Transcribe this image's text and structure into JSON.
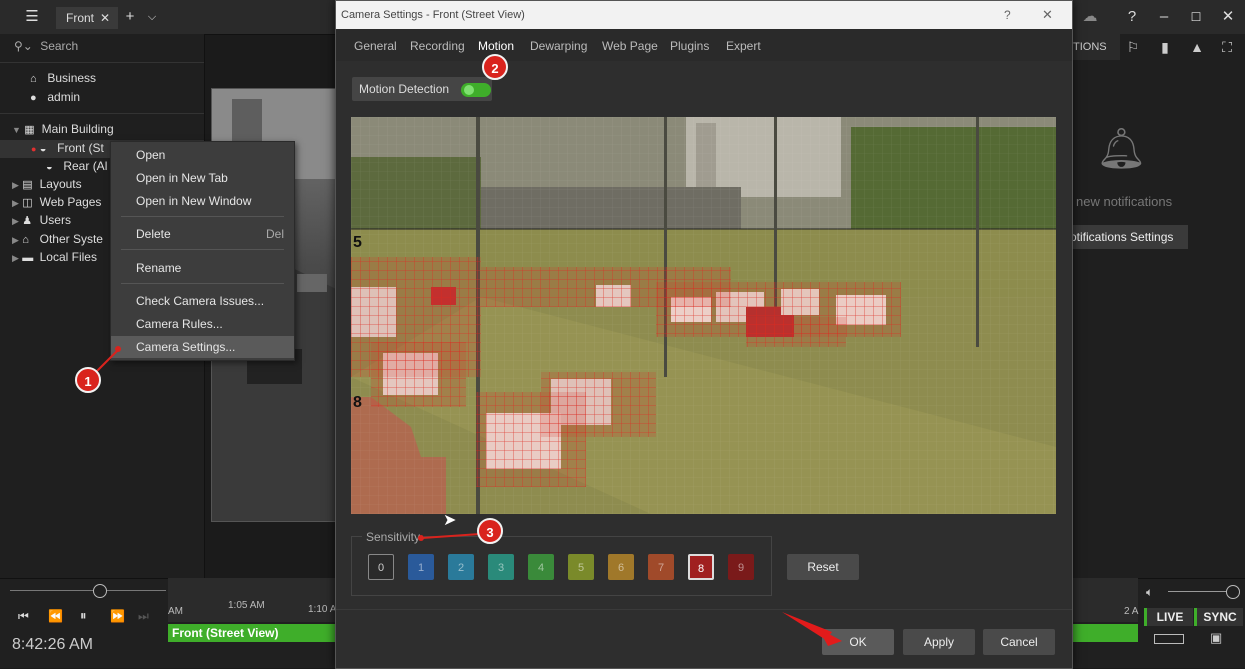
{
  "topbar": {
    "tab_label": "Front",
    "tab_close": "✕",
    "add_tab": "+",
    "tab_list": "⌵"
  },
  "left": {
    "search_placeholder": "Search",
    "tree": {
      "business": "Business",
      "admin": "admin",
      "main_building": "Main Building",
      "front": "Front (St",
      "rear": "Rear (Al",
      "layouts": "Layouts",
      "web_pages": "Web Pages",
      "users": "Users",
      "other_systems": "Other Syste",
      "local_files": "Local Files"
    }
  },
  "context_menu": {
    "items": [
      {
        "label": "Open"
      },
      {
        "label": "Open in New Tab"
      },
      {
        "label": "Open in New Window"
      },
      {
        "label": "Delete",
        "shortcut": "Del"
      },
      {
        "label": "Rename"
      },
      {
        "label": "Check Camera Issues..."
      },
      {
        "label": "Camera Rules..."
      },
      {
        "label": "Camera Settings..."
      }
    ]
  },
  "dialog": {
    "title": "Camera Settings - Front (Street View)",
    "help": "?",
    "close": "✕",
    "tabs": [
      "General",
      "Recording",
      "Motion",
      "Dewarping",
      "Web Page",
      "Plugins",
      "Expert"
    ],
    "motion_detection_label": "Motion Detection",
    "motion_detection_enabled": true,
    "zone_labels": {
      "upper": "5",
      "lower": "8"
    },
    "sensitivity_label": "Sensitivity",
    "sensitivity_levels": [
      "0",
      "1",
      "2",
      "3",
      "4",
      "5",
      "6",
      "7",
      "8",
      "9"
    ],
    "sensitivity_selected": "8",
    "sensitivity_colors": [
      "#444444",
      "#2a5a9a",
      "#2a7a9a",
      "#2a8a7a",
      "#3a8a3a",
      "#7a8a2a",
      "#a0782a",
      "#a04a2a",
      "#a02020",
      "#7a1a1a"
    ],
    "reset_label": "Reset",
    "ok_label": "OK",
    "apply_label": "Apply",
    "cancel_label": "Cancel"
  },
  "callouts": [
    "1",
    "2",
    "3"
  ],
  "right": {
    "notifications_tab": "TIONS",
    "no_notifications": "new notifications",
    "notifications_settings": "otifications Settings"
  },
  "timeline": {
    "clock": "8:42:26 AM",
    "tick_am": "AM",
    "tick_105": "1:05 AM",
    "tick_110": "1:10 A",
    "track_label": "Front (Street View)",
    "tick_right": "2 A",
    "live_label": "LIVE",
    "sync_label": "SYNC"
  }
}
